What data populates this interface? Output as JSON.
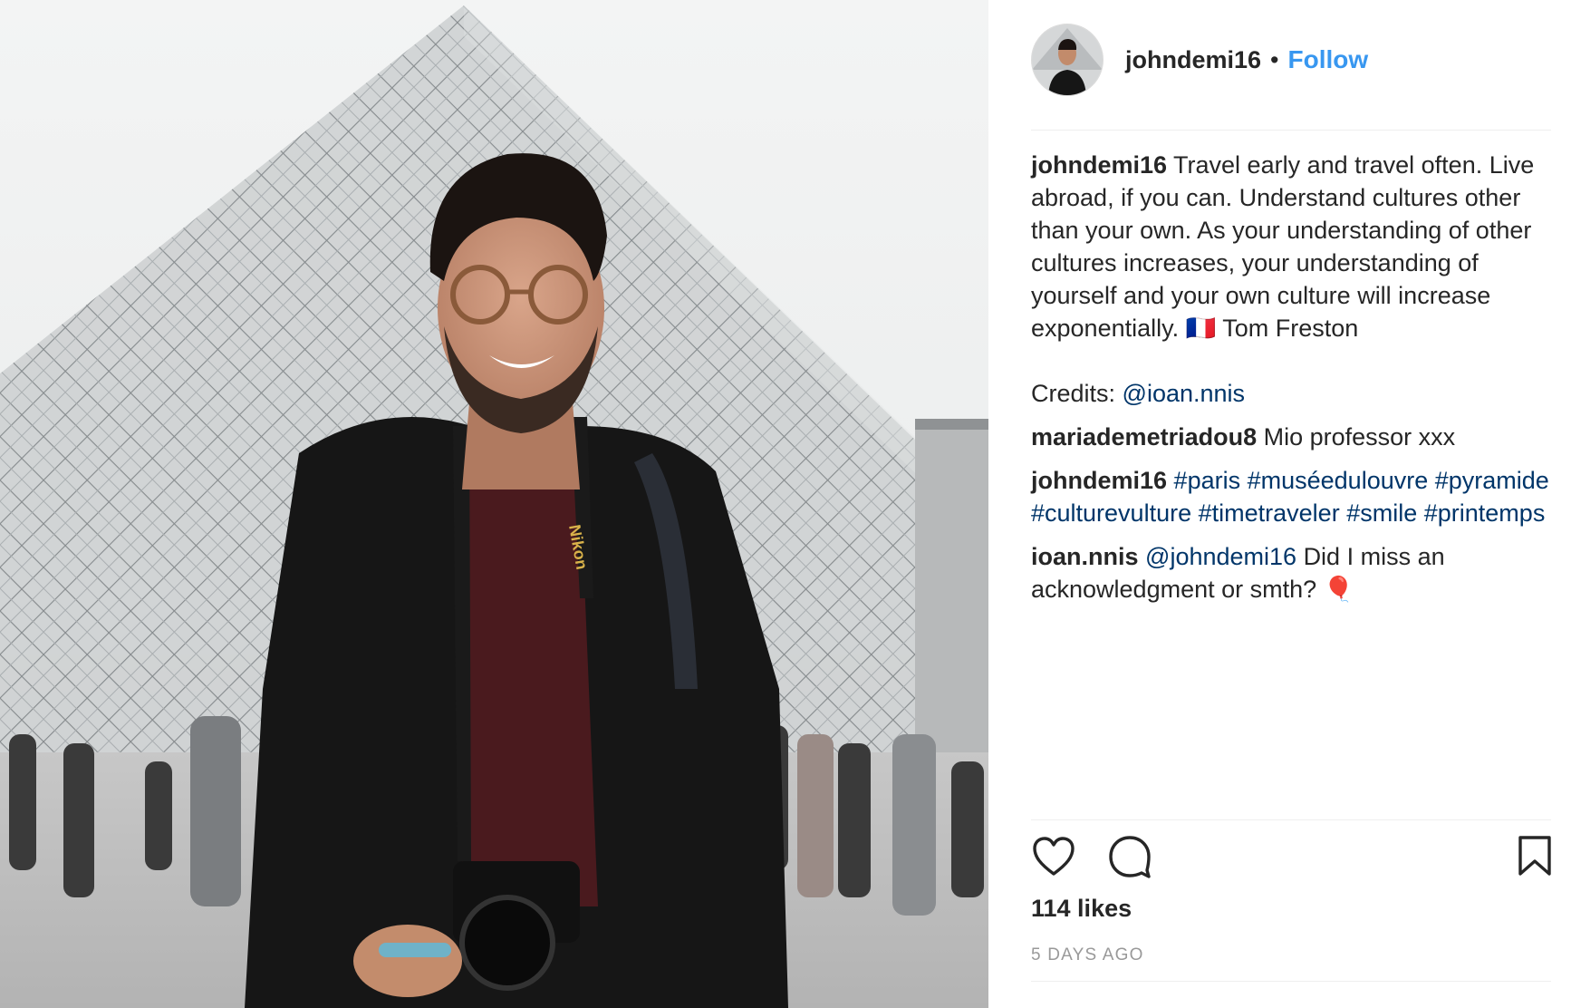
{
  "post": {
    "username": "johndemi16",
    "separator": "•",
    "follow_label": "Follow",
    "image_alt": "Man smiling in front of the Louvre pyramid",
    "camera_strap_text": "Nikon"
  },
  "comments": [
    {
      "user": "johndemi16",
      "text": "Travel early and travel often. Live abroad, if you can. Understand cultures other than your own. As your understanding of other cultures increases, your understanding of yourself and your own culture will increase exponentially. 🇫🇷 Tom Freston",
      "credits_label": "Credits:",
      "credits_mention": "@ioan.nnis"
    },
    {
      "user": "mariademetriadou8",
      "text": "Mio professor xxx"
    },
    {
      "user": "johndemi16",
      "hashtags": [
        "#paris",
        "#muséedulouvre",
        "#pyramide",
        "#culturevulture",
        "#timetraveler",
        "#smile",
        "#printemps"
      ]
    },
    {
      "user": "ioan.nnis",
      "mention": "@johndemi16",
      "text": "Did I miss an acknowledgment or smth? 🎈"
    }
  ],
  "actions": {
    "like_icon": "heart-icon",
    "comment_icon": "comment-bubble-icon",
    "save_icon": "bookmark-icon"
  },
  "likes_text": "114 likes",
  "age_text": "5 DAYS AGO",
  "colors": {
    "link_blue": "#003569",
    "follow_blue": "#3897f0",
    "text": "#262626",
    "muted": "#999999",
    "divider": "#efefef"
  }
}
